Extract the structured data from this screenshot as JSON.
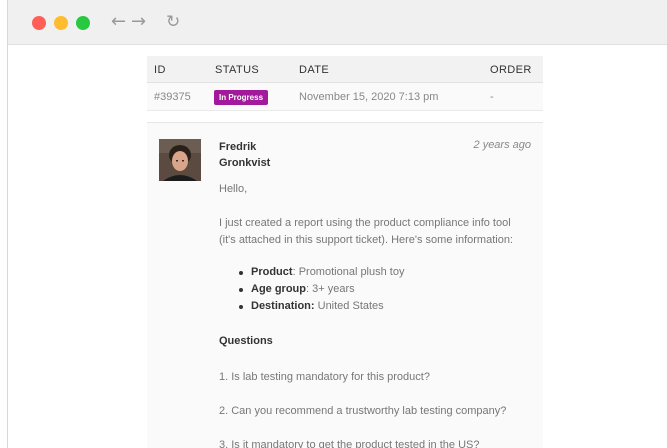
{
  "window": {
    "nav": {
      "back_glyph": "←",
      "forward_glyph": "→",
      "reload_glyph": "↻"
    },
    "icons": [
      "close-dot-icon",
      "minimize-dot-icon",
      "maximize-dot-icon",
      "back-arrow-icon",
      "forward-arrow-icon",
      "reload-icon"
    ],
    "colors": {
      "close": "#ff5f57",
      "minimize": "#febc2e",
      "maximize": "#28c840"
    }
  },
  "ticket_table": {
    "headers": {
      "id": "ID",
      "status": "STATUS",
      "date": "DATE",
      "order": "ORDER"
    },
    "row": {
      "id": "#39375",
      "status": "In Progress",
      "date": "November 15, 2020 7:13 pm",
      "order": "-"
    },
    "status_color": "#a3199b"
  },
  "message": {
    "author_first": "Fredrik",
    "author_last": "Gronkvist",
    "time": "2 years ago",
    "greeting": "Hello,",
    "intro_line1": "I just created a report using the product compliance info tool",
    "intro_line2": "(it's attached in this support ticket). Here's some information:",
    "details": [
      {
        "label": "Product",
        "separator": ": ",
        "value": "Promotional plush toy"
      },
      {
        "label": "Age group",
        "separator": ": ",
        "value": "3+ years"
      },
      {
        "label": "Destination:",
        "separator": " ",
        "value": "United States"
      }
    ],
    "questions_heading": "Questions",
    "questions": [
      "1. Is lab testing mandatory for this product?",
      "2. Can you recommend a trustworthy lab testing company?",
      "3. Is it mandatory to get the product tested in the US?"
    ]
  }
}
